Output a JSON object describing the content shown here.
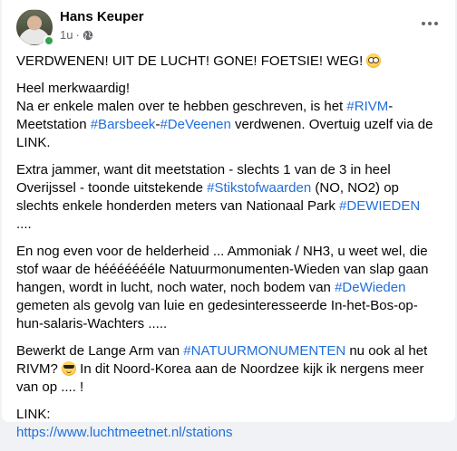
{
  "post": {
    "author": "Hans Keuper",
    "time": "1u",
    "separator": "·",
    "audience_icon": "globe-icon",
    "more_icon": "more-options-icon",
    "colors": {
      "link": "#216fdb",
      "online": "#31a24c",
      "meta": "#65676b"
    },
    "p1": {
      "text": "VERDWENEN! UIT DE LUCHT! GONE! FOETSIE! WEG! ",
      "emoji": "dizzy-face-emoji"
    },
    "p2": {
      "line1": "Heel merkwaardig!",
      "t1": "Na er enkele malen over te hebben geschreven, is het ",
      "tag1": "#RIVM",
      "t2": "-Meetstation ",
      "tag2": "#Barsbeek",
      "t3": "-",
      "tag3": "#DeVeenen",
      "t4": " verdwenen. Overtuig uzelf via de LINK."
    },
    "p3": {
      "t1": "Extra jammer, want dit meetstation - slechts 1 van de 3 in heel Overijssel - toonde uitstekende ",
      "tag1": "#Stikstofwaarden",
      "t2": " (NO, NO2) op slechts enkele honderden meters van Nationaal Park ",
      "tag2": "#DEWIEDEN",
      "t3": " ...."
    },
    "p4": {
      "t1": "En nog even voor de helderheid ... Ammoniak / NH3, u weet wel, die stof waar de héééééééle Natuurmonumenten-Wieden van slap gaan hangen, wordt in lucht, noch water, noch bodem van ",
      "tag1": "#DeWieden",
      "t2": " gemeten als gevolg van luie en gedesinteresseerde In-het-Bos-op-hun-salaris-Wachters ....."
    },
    "p5": {
      "t1": "Bewerkt de Lange Arm van ",
      "tag1": "#NATUURMONUMENTEN",
      "t2": " nu ook al het RIVM? ",
      "emoji": "sunglasses-face-emoji",
      "t3": " In dit Noord-Korea aan de Noordzee kijk ik nergens meer van op .... !"
    },
    "p6": {
      "label": "LINK:",
      "url": "https://www.luchtmeetnet.nl/stations"
    }
  }
}
